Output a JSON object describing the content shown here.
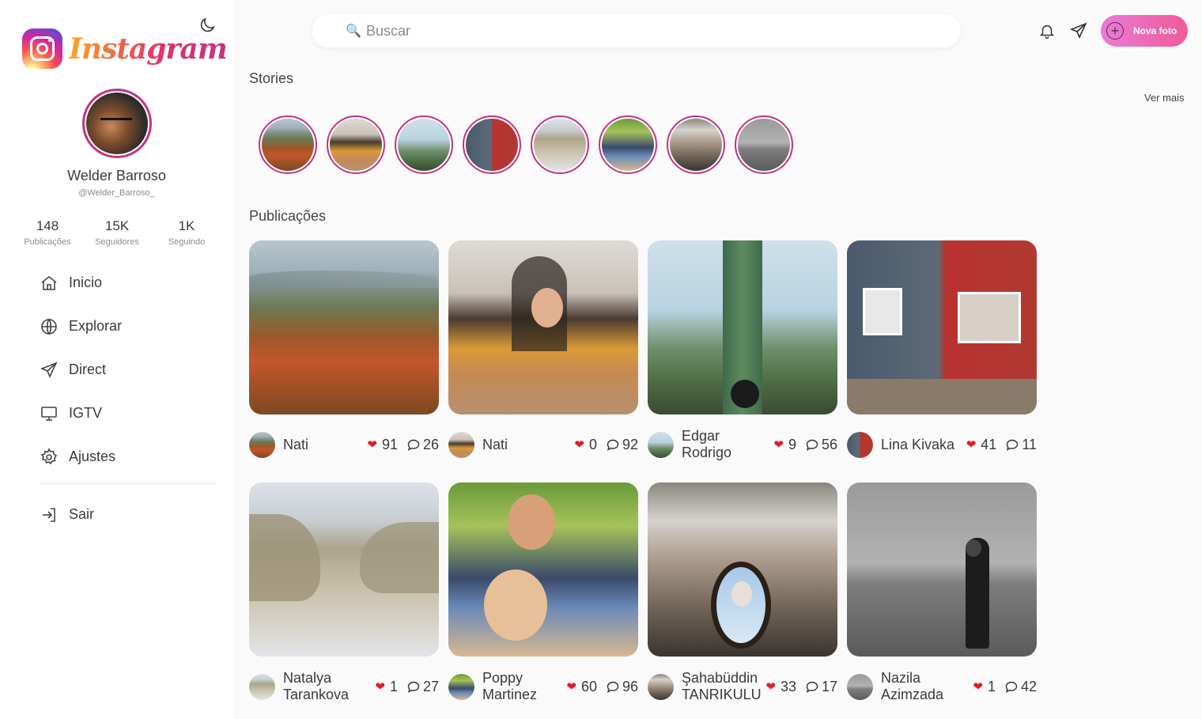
{
  "sidebar": {
    "logo_text": "Instagram",
    "profile": {
      "name": "Welder Barroso",
      "handle": "@Welder_Barroso_"
    },
    "stats": [
      {
        "num": "148",
        "label": "Publicações"
      },
      {
        "num": "15K",
        "label": "Seguidores"
      },
      {
        "num": "1K",
        "label": "Seguindo"
      }
    ],
    "nav": [
      {
        "label": "Inicio",
        "icon": "home-icon"
      },
      {
        "label": "Explorar",
        "icon": "globe-icon"
      },
      {
        "label": "Direct",
        "icon": "send-icon"
      },
      {
        "label": "IGTV",
        "icon": "monitor-icon"
      },
      {
        "label": "Ajustes",
        "icon": "gear-icon"
      }
    ],
    "logout_label": "Sair"
  },
  "header": {
    "search_placeholder": "Buscar",
    "new_photo_label": "Nova foto"
  },
  "stories": {
    "title": "Stories",
    "see_more": "Ver mais"
  },
  "publications": {
    "title": "Publicações",
    "posts": [
      {
        "author": "Nati",
        "likes": "91",
        "comments": "26"
      },
      {
        "author": "Nati",
        "likes": "0",
        "comments": "92"
      },
      {
        "author": "Edgar Rodrigo",
        "likes": "9",
        "comments": "56"
      },
      {
        "author": "Lina Kivaka",
        "likes": "41",
        "comments": "11"
      },
      {
        "author": "Natalya Tarankova",
        "likes": "1",
        "comments": "27"
      },
      {
        "author": "Poppy Martinez",
        "likes": "60",
        "comments": "96"
      },
      {
        "author": "Şahabüddin TANRIKULU",
        "likes": "33",
        "comments": "17"
      },
      {
        "author": "Nazila Azimzada",
        "likes": "1",
        "comments": "42"
      }
    ]
  },
  "colors": {
    "accent": "#c13584",
    "heart": "#e31b23",
    "button_start": "#e97bd6",
    "button_end": "#f05a9a"
  }
}
